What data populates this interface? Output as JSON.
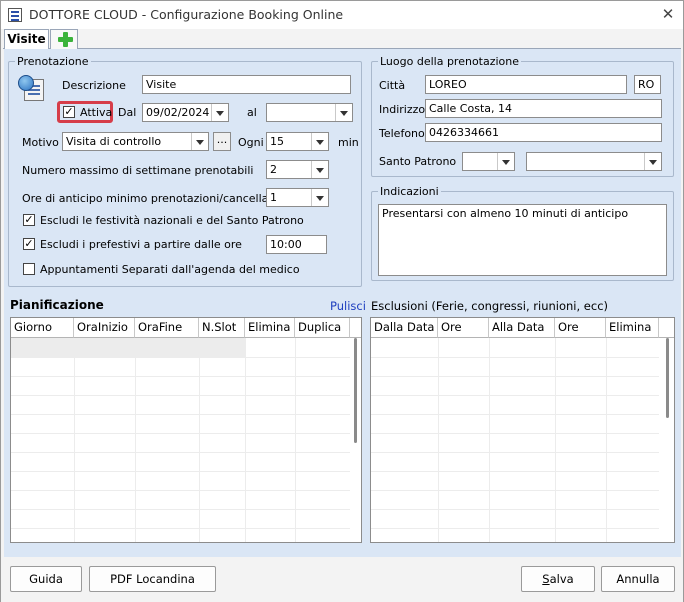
{
  "window": {
    "title": "DOTTORE CLOUD - Configurazione Booking Online",
    "close_glyph": "✕"
  },
  "tabs": [
    {
      "label": "Visite"
    },
    {
      "icon": "plus-icon"
    }
  ],
  "prenotazione": {
    "legend": "Prenotazione",
    "descrizione_label": "Descrizione",
    "descrizione_value": "Visite",
    "attiva_label": "Attiva",
    "attiva_checked": true,
    "dal_label": "Dal",
    "dal_value": "09/02/2024",
    "al_label": "al",
    "al_value": "",
    "motivo_label": "Motivo",
    "motivo_value": "Visita di controllo",
    "ellipsis": "...",
    "ogni_label": "Ogni",
    "ogni_value": "15",
    "min_label": "min",
    "settimane_label": "Numero massimo di settimane prenotabili",
    "settimane_value": "2",
    "anticipo_label": "Ore di anticipo minimo prenotazioni/cancellazioni",
    "anticipo_value": "1",
    "festivita_label": "Escludi le festività nazionali e del Santo Patrono",
    "festivita_checked": true,
    "prefestivi_label": "Escludi i prefestivi a partire dalle ore",
    "prefestivi_checked": true,
    "prefestivi_value": "10:00",
    "separati_label": "Appuntamenti Separati dall'agenda del medico",
    "separati_checked": false
  },
  "luogo": {
    "legend": "Luogo della prenotazione",
    "citta_label": "Città",
    "citta_value": "LOREO",
    "provincia_value": "RO",
    "indirizzo_label": "Indirizzo",
    "indirizzo_value": "Calle Costa, 14",
    "telefono_label": "Telefono",
    "telefono_value": "0426334661",
    "santo_label": "Santo Patrono",
    "santo_day": "",
    "santo_month": ""
  },
  "indicazioni": {
    "legend": "Indicazioni",
    "text": "Presentarsi con almeno 10 minuti di anticipo"
  },
  "pianificazione": {
    "title": "Pianificazione",
    "pulisci": "Pulisci",
    "columns": [
      "Giorno",
      "OraInizio",
      "OraFine",
      "N.Slot",
      "Elimina",
      "Duplica"
    ]
  },
  "esclusioni": {
    "title": "Esclusioni (Ferie, congressi, riunioni, ecc)",
    "columns": [
      "Dalla Data",
      "Ore",
      "Alla Data",
      "Ore",
      "Elimina"
    ]
  },
  "buttons": {
    "guida": "Guida",
    "pdf": "PDF Locandina",
    "salva_pre": "",
    "salva_u": "S",
    "salva_post": "alva",
    "annulla": "Annulla"
  },
  "colors": {
    "panel_bg": "#dae6f5",
    "highlight": "#d63d49",
    "link": "#1f3fbf"
  }
}
